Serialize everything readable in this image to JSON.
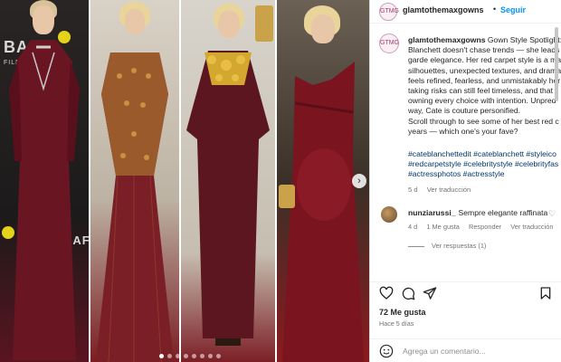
{
  "post": {
    "username": "glamtothemaxgowns",
    "follow_label": "Seguir",
    "avatar_text": "GTMG",
    "caption_text": " Gown Style Spotlight:\nBlanchett doesn't chase trends — she leads\ngarde elegance. Her red carpet style is a ma\nsilhouettes, unexpected textures, and drama\nfeels refined, fearless, and unmistakably her\ntaking risks can still feel timeless, and that t\nowning every choice with intention. Unpred\nway, Cate is couture personified.\nScroll through to see some of her best red c\nyears — which one's your fave?",
    "hashtags": "#cateblanchettedit #cateblanchett #styleico\n#redcarpetstyle #celebritystyle #celebrityfas\n#actressphotos #actresstyle",
    "age_short": "5 d",
    "see_translation": "Ver traducción",
    "likes": "72 Me gusta",
    "age_long": "Hace 5 días",
    "add_comment_placeholder": "Agrega un comentario..."
  },
  "comment": {
    "username": "nunziarussi_",
    "text": "Sempre elegante raffinata",
    "age": "4 d",
    "likes": "1 Me gusta",
    "reply": "Responder",
    "see_translation": "Ver traducción",
    "view_replies": "Ver respuestas (1)"
  },
  "photo": {
    "backdrop_text_1": "BAF",
    "backdrop_text_2": "FILM AWARDS",
    "backdrop_text_3": "BAF",
    "dots_count": 8,
    "active_dot": 0
  },
  "colors": {
    "link": "#00376b",
    "follow": "#0095f6",
    "muted": "#737373",
    "gown": "#6a1522"
  },
  "icons": [
    "heart-icon",
    "comment-icon",
    "share-icon",
    "save-icon",
    "emoji-icon",
    "chevron-right-icon"
  ]
}
